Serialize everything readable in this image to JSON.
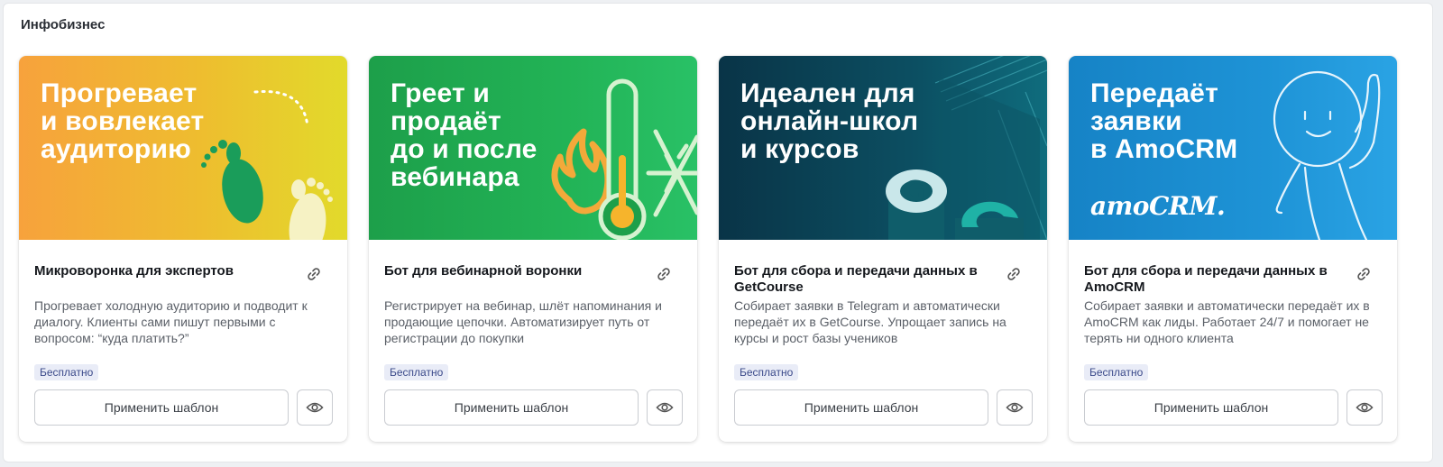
{
  "section": {
    "title": "Инфобизнес"
  },
  "cards": [
    {
      "banner_text": "Прогревает\nи вовлекает\nаудиторию",
      "banner_gradient": [
        "#f7a23c",
        "#e4d92a"
      ],
      "art_icon": "footprints-icon",
      "title": "Микроворонка для экспертов",
      "description": "Прогревает холодную аудиторию и подводит к диалогу. Клиенты сами пишут первыми с вопросом: “куда платить?”",
      "badge": "Бесплатно",
      "apply_label": "Применить шаблон"
    },
    {
      "banner_text": "Греет и\nпродаёт\nдо и после\nвебинара",
      "banner_gradient": [
        "#1a9e48",
        "#27c162"
      ],
      "art_icon": "thermometer-flame-snowflake-icon",
      "title": "Бот для вебинарной воронки",
      "description": "Регистрирует на вебинар, шлёт напоминания и продающие цепочки. Автоматизирует путь от регистрации до покупки",
      "badge": "Бесплатно",
      "apply_label": "Применить шаблон"
    },
    {
      "banner_text": "Идеален для\nонлайн-школ\nи курсов",
      "banner_gradient": [
        "#0b3b52",
        "#0f6b7e"
      ],
      "art_icon": "getcourse-logo-icon",
      "title": "Бот для сбора и передачи данных в GetCourse",
      "description": "Собирает заявки в Telegram и автоматически передаёт их в GetCourse. Упрощает запись на курсы и рост базы учеников",
      "badge": "Бесплатно",
      "apply_label": "Применить шаблон"
    },
    {
      "banner_text": "Передаёт\nзаявки\nв AmoCRM",
      "banner_gradient": [
        "#1787c9",
        "#2aa0e2"
      ],
      "art_icon": "waving-figure-icon",
      "logo_text": "amoCRM.",
      "title": "Бот для сбора и передачи данных в AmoCRM",
      "description": "Собирает заявки и автоматически передаёт их в AmoCRM как лиды. Работает 24/7 и помогает не терять ни одного клиента",
      "badge": "Бесплатно",
      "apply_label": "Применить шаблон"
    }
  ]
}
